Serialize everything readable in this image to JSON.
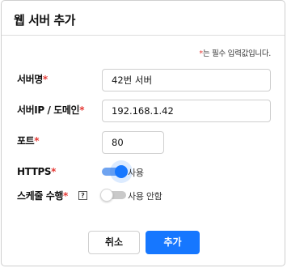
{
  "dialog": {
    "title": "웹 서버 추가",
    "required_star": "*",
    "required_note": "는 필수 입력값입니다."
  },
  "fields": {
    "server_name": {
      "label": "서버명",
      "star": "*",
      "value": "42번 서버"
    },
    "server_ip": {
      "label": "서버IP / 도메인",
      "star": "*",
      "value": "192.168.1.42"
    },
    "port": {
      "label": "포트",
      "star": "*",
      "value": "80"
    },
    "https": {
      "label": "HTTPS",
      "star": "*",
      "state": "on",
      "toggle_label": "사용"
    },
    "schedule": {
      "label": "스케줄 수행",
      "star": "*",
      "help": "?",
      "state": "off",
      "toggle_label": "사용 안함"
    }
  },
  "buttons": {
    "cancel": "취소",
    "add": "추가"
  },
  "colors": {
    "primary": "#1677ff",
    "required": "#e53935"
  }
}
